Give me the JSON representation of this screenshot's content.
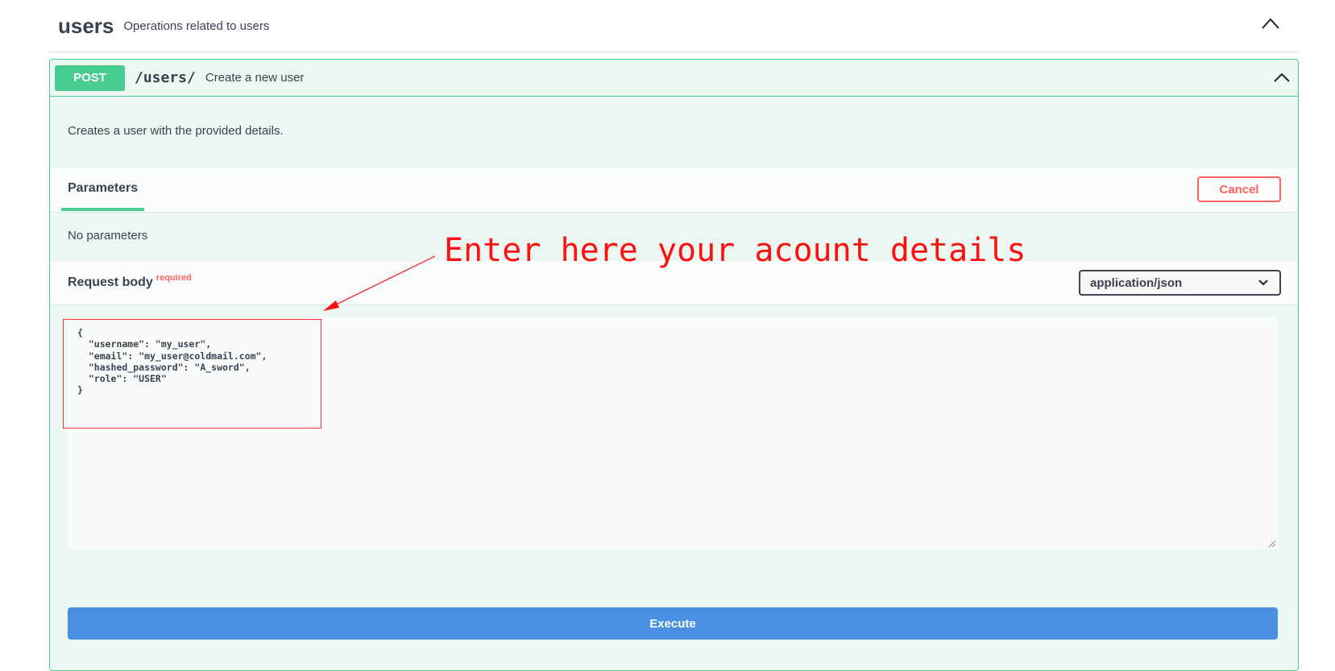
{
  "tag": {
    "name": "users",
    "description": "Operations related to users"
  },
  "operation": {
    "method": "POST",
    "path": "/users/",
    "summary": "Create a new user",
    "description": "Creates a user with the provided details."
  },
  "parameters": {
    "tab_label": "Parameters",
    "cancel_label": "Cancel",
    "empty_text": "No parameters"
  },
  "request_body": {
    "title": "Request body",
    "required_label": "required",
    "content_type": "application/json",
    "value": "{\n  \"username\": \"my_user\",\n  \"email\": \"my_user@coldmail.com\",\n  \"hashed_password\": \"A_sword\",\n  \"role\": \"USER\"\n}"
  },
  "annotation": {
    "text": "Enter here your acount details",
    "color": "#ff1010"
  },
  "execute_label": "Execute",
  "colors": {
    "post_green": "#49cc90",
    "cancel_red": "#ff6060",
    "execute_blue": "#4990e2",
    "text": "#3b4151"
  }
}
